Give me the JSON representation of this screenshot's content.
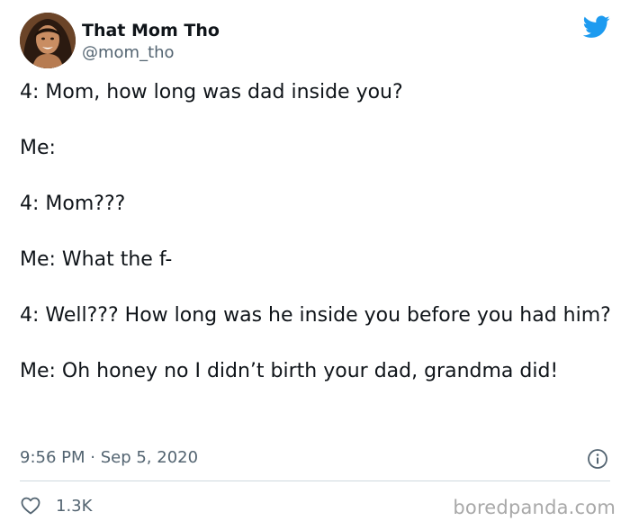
{
  "author": {
    "display_name": "That Mom Tho",
    "handle": "@mom_tho"
  },
  "tweet": {
    "lines": [
      "4: Mom, how long was dad inside you?",
      "Me:",
      "4: Mom???",
      "Me: What the f-",
      "4: Well??? How long was he inside you before you had him?",
      "Me: Oh honey no I didn’t birth your dad, grandma did!"
    ],
    "timestamp": "9:56 PM · Sep 5, 2020"
  },
  "engagement": {
    "likes": "1.3K"
  },
  "watermark": "boredpanda.com",
  "icons": {
    "brand": "twitter-bird-icon",
    "info": "info-icon",
    "like": "heart-icon"
  },
  "colors": {
    "brand_blue": "#1d9bf0",
    "text": "#0f1419",
    "muted": "#536471",
    "divider": "#cfd9de",
    "watermark": "#a8a8a8"
  }
}
